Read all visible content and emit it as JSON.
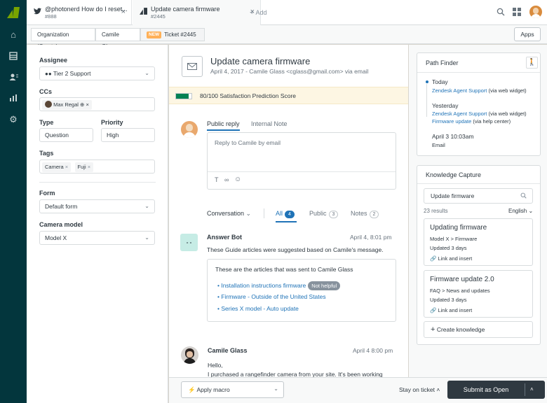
{
  "tabs": [
    {
      "title": "@photonerd How do I reset...",
      "sub": "#888"
    },
    {
      "title": "Update camera firmware",
      "sub": "#2445"
    }
  ],
  "add_tab_label": "Add",
  "subbar": {
    "organization": "Organization (Create)",
    "requester": "Camile Glass",
    "new_badge": "NEW",
    "ticket": "Ticket #2445",
    "apps": "Apps"
  },
  "left": {
    "assignee_label": "Assignee",
    "assignee_value": "Tier 2 Support",
    "ccs_label": "CCs",
    "cc_name": "Max Regal",
    "type_label": "Type",
    "type_value": "Question",
    "priority_label": "Priority",
    "priority_value": "High",
    "tags_label": "Tags",
    "tags": [
      "Camera",
      "Fuji"
    ],
    "form_label": "Form",
    "form_value": "Default form",
    "model_label": "Camera model",
    "model_value": "Model X"
  },
  "ticket": {
    "subject": "Update camera firmware",
    "meta": "April 4, 2017 - Camile Glass <cglass@gmail.com> via email",
    "satisfaction": "80/100 Satisfaction Prediction Score",
    "satisfaction_value": 0.8,
    "reply_tab": "Public reply",
    "note_tab": "Internal Note",
    "reply_placeholder": "Reply to Camile by email",
    "conv_label": "Conversation",
    "all_label": "All",
    "all_count": "4",
    "public_label": "Public",
    "public_count": "3",
    "notes_label": "Notes",
    "notes_count": "2"
  },
  "bot": {
    "name": "Answer Bot",
    "time": "April 4, 8:01 pm",
    "text": "These Guide articles were suggested based on Camile's message.",
    "box_title": "These are the articles that was sent to Camile Glass",
    "articles": [
      "Installation instructions firmware",
      "Firmware - Outside of the United States",
      "Series X model - Auto update"
    ],
    "not_helpful": "Not helpful"
  },
  "customer": {
    "name": "Camile Glass",
    "time": "April 4 8:00 pm",
    "line1": "Hello,",
    "line2": "I purchased a rangefinder camera from your site. It's been working"
  },
  "footer": {
    "macro": "Apply macro",
    "stay": "Stay on ticket",
    "submit": "Submit as Open"
  },
  "pathfinder": {
    "title": "Path Finder",
    "today": "Today",
    "today_link": "Zendesk Agent Support",
    "today_via": "(via web widget)",
    "yesterday": "Yesterday",
    "y_link1": "Zendesk Agent Support",
    "y_via1": "(via web widget)",
    "y_link2": "Firmware update",
    "y_via2": "(via help center)",
    "april": "April 3 10:03am",
    "email": "Email"
  },
  "knowledge": {
    "title": "Knowledge Capture",
    "search_value": "Update firmware",
    "results": "23 results",
    "language": "English",
    "items": [
      {
        "title": "Updating firmware",
        "path": "Model X > Firmware",
        "updated": "Updated 3 days",
        "action": "Link and insert"
      },
      {
        "title": "Firmware update 2.0",
        "path": "FAQ > News and updates",
        "updated": "Updated 3 days",
        "action": "Link and insert"
      }
    ],
    "create": "Create knowledge"
  },
  "colors": {
    "nav_bg": "#03363d",
    "link": "#1f73b7",
    "brand_green": "#78a300",
    "submit_bg": "#2f3941",
    "badge_new": "#ffb057"
  }
}
